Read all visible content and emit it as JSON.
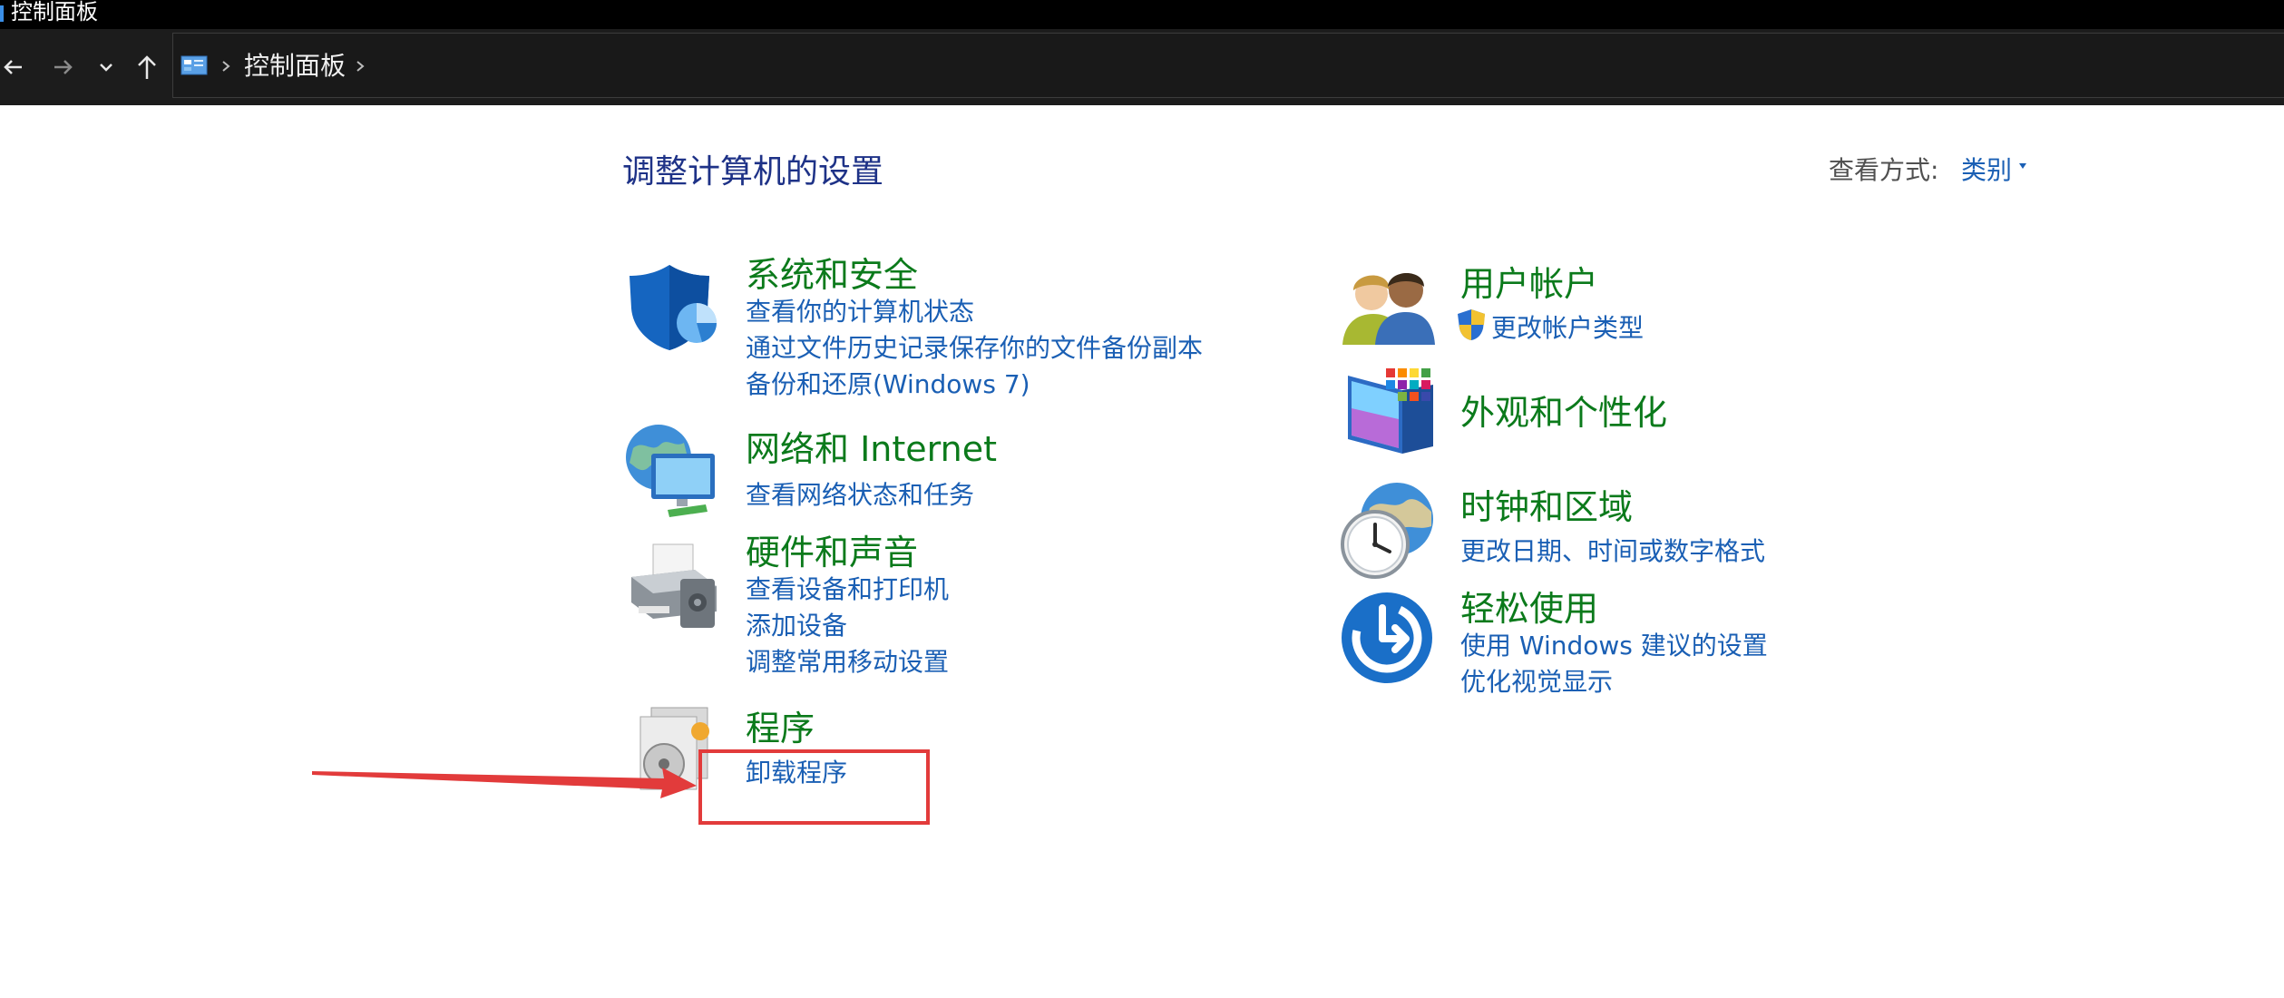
{
  "window": {
    "title": "控制面板"
  },
  "address": {
    "path": "控制面板"
  },
  "main": {
    "heading": "调整计算机的设置",
    "view_by_label": "查看方式:",
    "view_by_value": "类别"
  },
  "categories": [
    {
      "title": "系统和安全",
      "links": [
        "查看你的计算机状态",
        "通过文件历史记录保存你的文件备份副本",
        "备份和还原(Windows 7)"
      ]
    },
    {
      "title": "网络和 Internet",
      "links": [
        "查看网络状态和任务"
      ]
    },
    {
      "title": "硬件和声音",
      "links": [
        "查看设备和打印机",
        "添加设备",
        "调整常用移动设置"
      ]
    },
    {
      "title": "程序",
      "links": [
        "卸载程序"
      ]
    },
    {
      "title": "用户帐户",
      "links": [
        "更改帐户类型"
      ]
    },
    {
      "title": "外观和个性化",
      "links": []
    },
    {
      "title": "时钟和区域",
      "links": [
        "更改日期、时间或数字格式"
      ]
    },
    {
      "title": "轻松使用",
      "links": [
        "使用 Windows 建议的设置",
        "优化视觉显示"
      ]
    }
  ],
  "colors": {
    "category_title": "#0b7a1b",
    "link": "#1a5fb4",
    "heading": "#1e3287",
    "annotation": "#e23b3b"
  },
  "icons": {
    "system_security": "shield-icon",
    "network": "globe-monitor-icon",
    "hardware": "printer-icon",
    "programs": "program-disc-icon",
    "user_accounts": "users-icon",
    "appearance": "monitor-palette-icon",
    "clock_region": "clock-globe-icon",
    "ease_of_access": "ease-of-access-icon"
  }
}
